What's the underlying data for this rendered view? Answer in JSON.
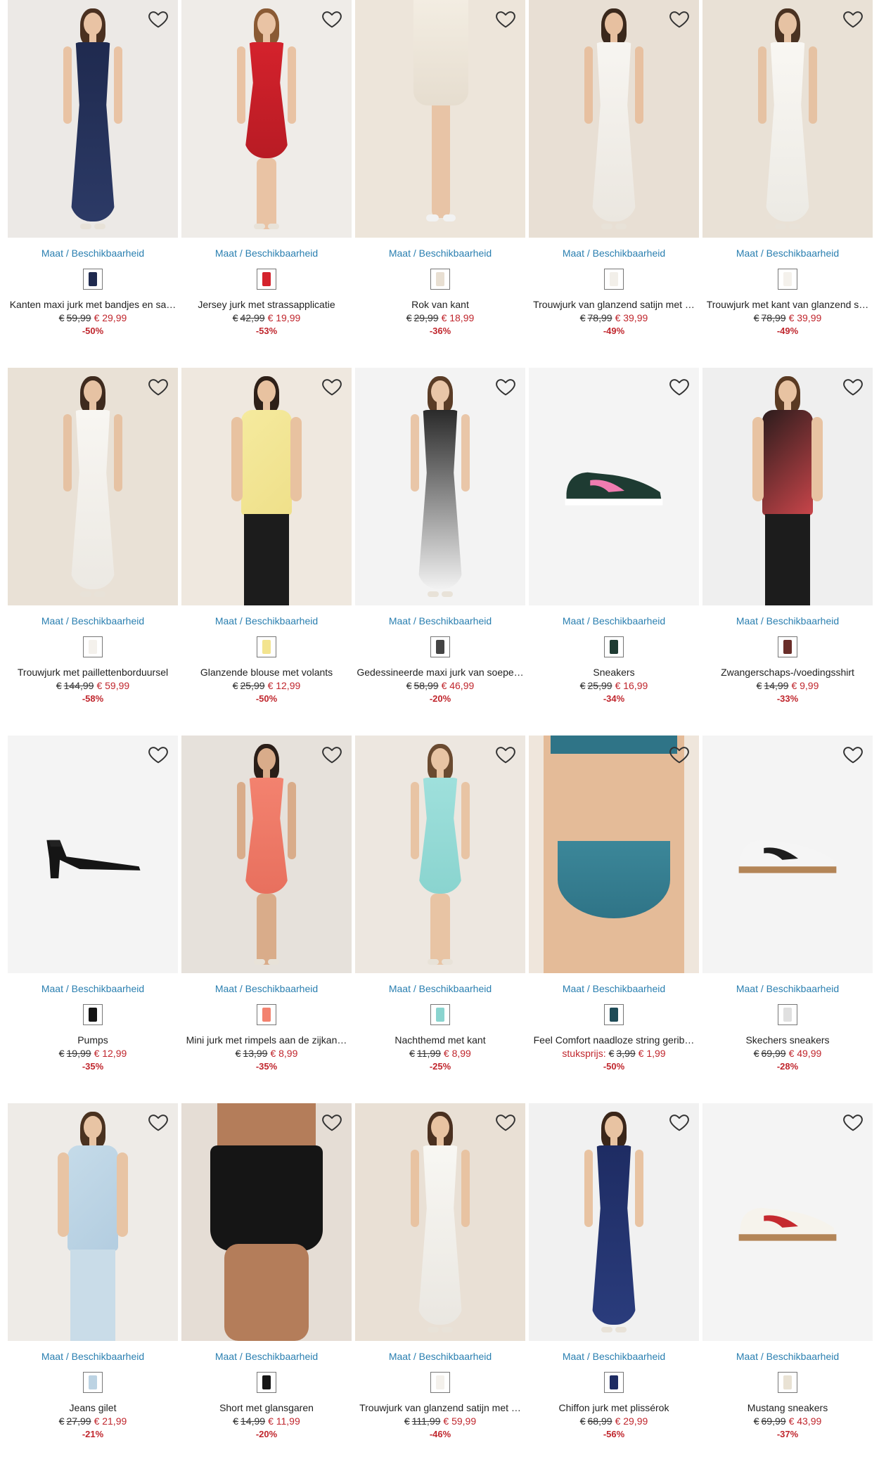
{
  "ui": {
    "size_link_label": "Maat / Beschikbaarheid",
    "favorite_icon": "heart-outline-icon",
    "currency": "€",
    "accent_link_color": "#2a7fb0",
    "sale_color": "#c0262d"
  },
  "products": [
    {
      "title": "Kanten maxi jurk met bandjes en sa…",
      "old_price": "59,99",
      "new_price": "€ 29,99",
      "discount": "-50%",
      "bg": "#ece9e6",
      "kind": "dress-long",
      "c1": "#1f2a4f",
      "c2": "#2c3a66",
      "skin": "#e9c3a4",
      "hair": "#4a3020",
      "swatch": "#1f2a4f"
    },
    {
      "title": "Jersey jurk met strassapplicatie",
      "old_price": "42,99",
      "new_price": "€ 19,99",
      "discount": "-53%",
      "bg": "#efece8",
      "kind": "dress-mid",
      "c1": "#d4222c",
      "c2": "#b81b24",
      "skin": "#e9c3a4",
      "hair": "#8a5a34",
      "swatch": "#d4222c"
    },
    {
      "title": "Rok van kant",
      "old_price": "29,99",
      "new_price": "€ 18,99",
      "discount": "-36%",
      "bg": "#ede5da",
      "kind": "skirt",
      "c1": "#f3ede2",
      "c2": "#e6ddcf",
      "skin": "#e8c4a6",
      "hair": "#6b4a2e",
      "swatch": "#e8dfd2"
    },
    {
      "title": "Trouwjurk van glanzend satijn met …",
      "old_price": "78,99",
      "new_price": "€ 39,99",
      "discount": "-49%",
      "bg": "#e8dfd4",
      "kind": "dress-long",
      "c1": "#f7f5f1",
      "c2": "#ebe7e0",
      "skin": "#e7c0a0",
      "hair": "#3a281c",
      "swatch": "#f2efe9"
    },
    {
      "title": "Trouwjurk met kant van glanzend s…",
      "old_price": "78,99",
      "new_price": "€ 39,99",
      "discount": "-49%",
      "bg": "#e9e1d6",
      "kind": "dress-long",
      "c1": "#f9f7f3",
      "c2": "#eceae4",
      "skin": "#e6c2a3",
      "hair": "#4a3222",
      "swatch": "#f4f1ec"
    },
    {
      "title": "Trouwjurk met paillettenborduursel",
      "old_price": "144,99",
      "new_price": "€ 59,99",
      "discount": "-58%",
      "bg": "#e9e1d6",
      "kind": "dress-long",
      "c1": "#f8f6f2",
      "c2": "#ece9e3",
      "skin": "#e6c2a3",
      "hair": "#3e2a1e",
      "swatch": "#f4f1ec"
    },
    {
      "title": "Glanzende blouse met volants",
      "old_price": "25,99",
      "new_price": "€ 12,99",
      "discount": "-50%",
      "bg": "#efe8df",
      "kind": "top",
      "c1": "#f5ea9e",
      "c2": "#efe08a",
      "skin": "#e8c2a0",
      "hair": "#2e2018",
      "swatch": "#f3e48f"
    },
    {
      "title": "Gedessineerde maxi jurk van soepe…",
      "old_price": "58,99",
      "new_price": "€ 46,99",
      "discount": "-20%",
      "bg": "#f3f3f3",
      "kind": "dress-long",
      "c1": "#2a2a2a",
      "c2": "#f2f2f2",
      "skin": "#e9c6a8",
      "hair": "#5a3c26",
      "swatch": "#444444"
    },
    {
      "title": "Sneakers",
      "old_price": "25,99",
      "new_price": "€ 16,99",
      "discount": "-34%",
      "bg": "#f4f4f4",
      "kind": "sneaker",
      "c1": "#1e3b32",
      "c2": "#f07cb0",
      "skin": "#ffffff",
      "hair": "#ffffff",
      "swatch": "#1e3b32"
    },
    {
      "title": "Zwangerschaps-/voedingsshirt",
      "old_price": "14,99",
      "new_price": "€ 9,99",
      "discount": "-33%",
      "bg": "#efefef",
      "kind": "top",
      "c1": "#2b1c1c",
      "c2": "#c9454a",
      "skin": "#e8c3a2",
      "hair": "#5a3a22",
      "swatch": "#6a2e2a"
    },
    {
      "title": "Pumps",
      "old_price": "19,99",
      "new_price": "€ 12,99",
      "discount": "-35%",
      "bg": "#f4f4f4",
      "kind": "pump",
      "c1": "#151515",
      "c2": "#222222",
      "skin": "#ffffff",
      "hair": "#ffffff",
      "swatch": "#151515"
    },
    {
      "title": "Mini jurk met rimpels aan de zijkan…",
      "old_price": "13,99",
      "new_price": "€ 8,99",
      "discount": "-35%",
      "bg": "#e6e1db",
      "kind": "dress-mid",
      "c1": "#f3826f",
      "c2": "#e8705e",
      "skin": "#d9ac8a",
      "hair": "#2a1e18",
      "swatch": "#f3826f"
    },
    {
      "title": "Nachthemd met kant",
      "old_price": "11,99",
      "new_price": "€ 8,99",
      "discount": "-25%",
      "bg": "#ede7e0",
      "kind": "dress-mid",
      "c1": "#9fe0dc",
      "c2": "#8ad4cf",
      "skin": "#e8c4a4",
      "hair": "#6a4a30",
      "swatch": "#8ad4cf"
    },
    {
      "title": "Feel Comfort naadloze string gerib…",
      "unit_label": "stuksprijs:",
      "old_price": "3,99",
      "new_price": "€ 1,99",
      "discount": "-50%",
      "bg": "#efe6dc",
      "kind": "brief",
      "c1": "#2f7487",
      "c2": "#3c8799",
      "skin": "#e4bb98",
      "hair": "#ffffff",
      "swatch": "#1e4b57"
    },
    {
      "title": "Skechers sneakers",
      "old_price": "69,99",
      "new_price": "€ 49,99",
      "discount": "-28%",
      "bg": "#f4f4f4",
      "kind": "sneaker",
      "c1": "#f5f5f5",
      "c2": "#1d1d1d",
      "skin": "#ffffff",
      "hair": "#ffffff",
      "swatch": "#e0e0e0"
    },
    {
      "title": "Jeans gilet",
      "old_price": "27,99",
      "new_price": "€ 21,99",
      "discount": "-21%",
      "bg": "#eeebe7",
      "kind": "top",
      "c1": "#c5dbe9",
      "c2": "#b3cde0",
      "skin": "#e8c4a4",
      "hair": "#4a3220",
      "swatch": "#bcd3e3"
    },
    {
      "title": "Short met glansgaren",
      "old_price": "14,99",
      "new_price": "€ 11,99",
      "discount": "-20%",
      "bg": "#e5ddd5",
      "kind": "short",
      "c1": "#151515",
      "c2": "#262626",
      "skin": "#b47d5a",
      "hair": "#ffffff",
      "swatch": "#151515"
    },
    {
      "title": "Trouwjurk van glanzend satijn met …",
      "old_price": "111,99",
      "new_price": "€ 59,99",
      "discount": "-46%",
      "bg": "#e9e0d5",
      "kind": "dress-long",
      "c1": "#f8f7f3",
      "c2": "#eae7e1",
      "skin": "#e8c3a2",
      "hair": "#4a3020",
      "swatch": "#f4f1ec"
    },
    {
      "title": "Chiffon jurk met plissérok",
      "old_price": "68,99",
      "new_price": "€ 29,99",
      "discount": "-56%",
      "bg": "#f1f1f1",
      "kind": "dress-long",
      "c1": "#1e2c63",
      "c2": "#2a3c7c",
      "skin": "#e8c3a2",
      "hair": "#3a261a",
      "swatch": "#1e2c63"
    },
    {
      "title": "Mustang sneakers",
      "old_price": "69,99",
      "new_price": "€ 43,99",
      "discount": "-37%",
      "bg": "#f4f4f4",
      "kind": "sneaker",
      "c1": "#f6f3ec",
      "c2": "#c52a2f",
      "skin": "#ffffff",
      "hair": "#ffffff",
      "swatch": "#e9e2d4"
    }
  ]
}
